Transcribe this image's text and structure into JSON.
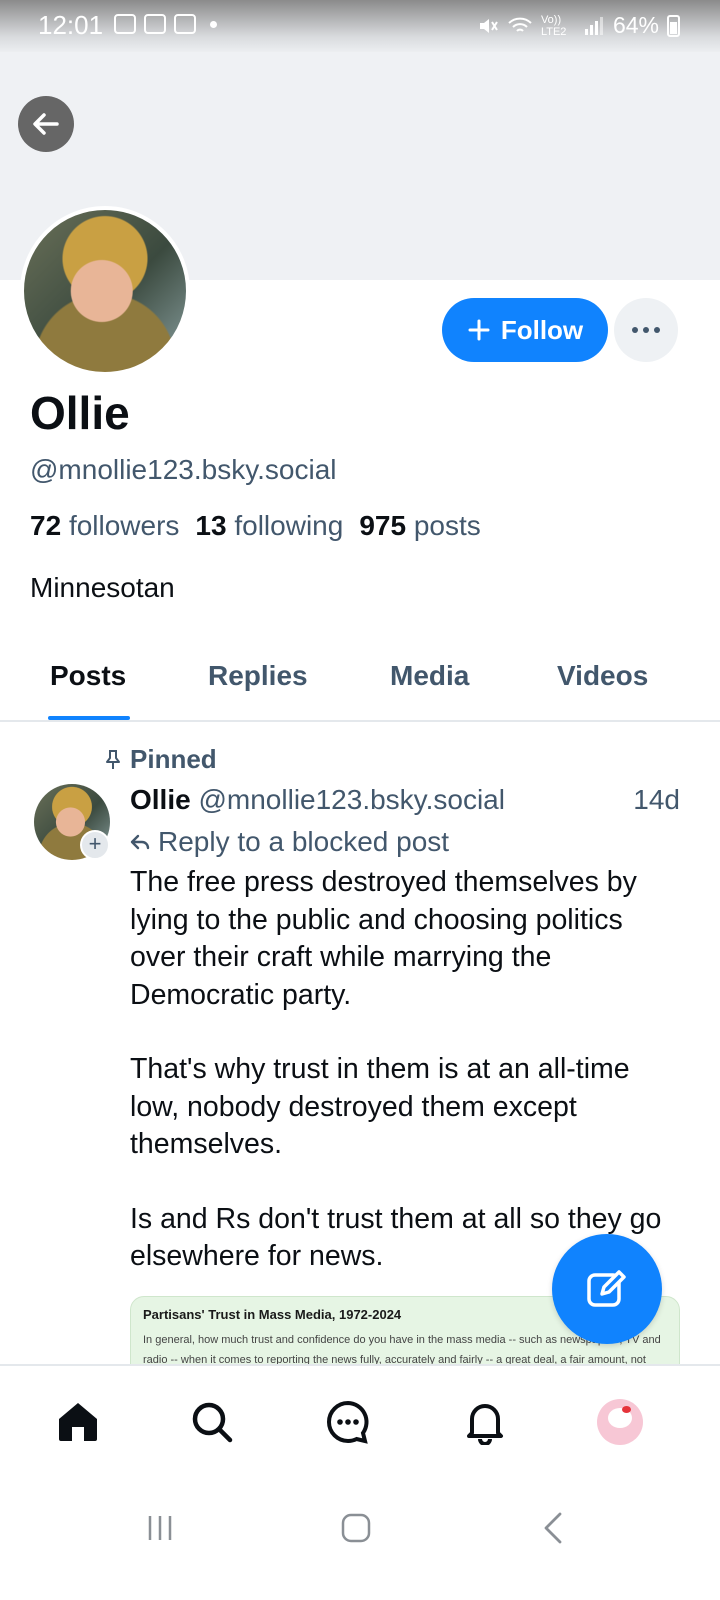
{
  "status_bar": {
    "time": "12:01",
    "battery": "64%",
    "signal_label": "Vo)) LTE2"
  },
  "profile": {
    "display_name": "Ollie",
    "handle": "@mnollie123.bsky.social",
    "followers_count": "72",
    "followers_label": "followers",
    "following_count": "13",
    "following_label": "following",
    "posts_count": "975",
    "posts_label": "posts",
    "bio": "Minnesotan",
    "follow_label": "Follow"
  },
  "tabs": [
    {
      "label": "Posts",
      "active": true
    },
    {
      "label": "Replies",
      "active": false
    },
    {
      "label": "Media",
      "active": false
    },
    {
      "label": "Videos",
      "active": false
    }
  ],
  "post": {
    "pinned_label": "Pinned",
    "author_name": "Ollie",
    "author_handle": "@mnollie123.bsky.social",
    "time": "14d",
    "reply_context": "Reply to a blocked post",
    "paragraphs": [
      "The free press destroyed themselves by lying to the public and choosing politics over their craft while marrying the Democratic party.",
      "That's why trust in them is at an all-time low, nobody destroyed them except themselves.",
      "Is and Rs don't trust them at all so they go elsewhere for news."
    ],
    "embed": {
      "title": "Partisans' Trust in Mass Media, 1972-2024",
      "text": "In general, how much trust and confidence do you have in the mass media -- such as newspapers, TV and radio -- when it comes to reporting the news fully, accurately and fairly -- a great deal, a fair amount, not very"
    }
  },
  "bottom_nav": [
    "home-icon",
    "search-icon",
    "chat-icon",
    "bell-icon",
    "profile-avatar"
  ],
  "colors": {
    "accent": "#1083fe",
    "muted": "#42576c",
    "text": "#0b0f14"
  }
}
